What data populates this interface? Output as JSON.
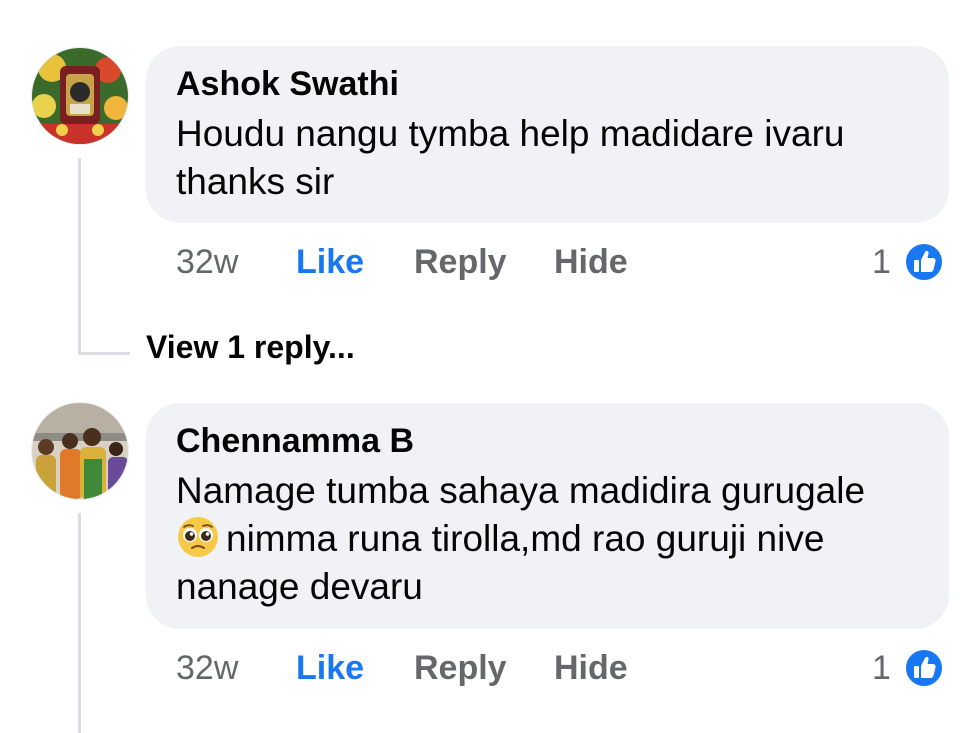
{
  "comments": [
    {
      "author": "Ashok Swathi",
      "text_line1": "Houdu nangu tymba help madidare ivaru",
      "text_line2": "thanks sir",
      "time": "32w",
      "like_label": "Like",
      "reply_label": "Reply",
      "hide_label": "Hide",
      "reaction_count": "1",
      "reaction_icon": "thumbs-up-icon",
      "view_replies": "View 1 reply..."
    },
    {
      "author": "Chennamma B",
      "text_line1": "Namage tumba sahaya madidira gurugale",
      "text_line2": "nimma runa tirolla,md rao guruji nive",
      "text_line3": "nanage devaru",
      "emoji": "pleading-face-emoji",
      "time": "32w",
      "like_label": "Like",
      "reply_label": "Reply",
      "hide_label": "Hide",
      "reaction_count": "1",
      "reaction_icon": "thumbs-up-icon"
    }
  ],
  "colors": {
    "accent": "#1877f2",
    "bubble": "#f0f2f5",
    "secondary_text": "#65676b",
    "thread_line": "#dadde1"
  }
}
